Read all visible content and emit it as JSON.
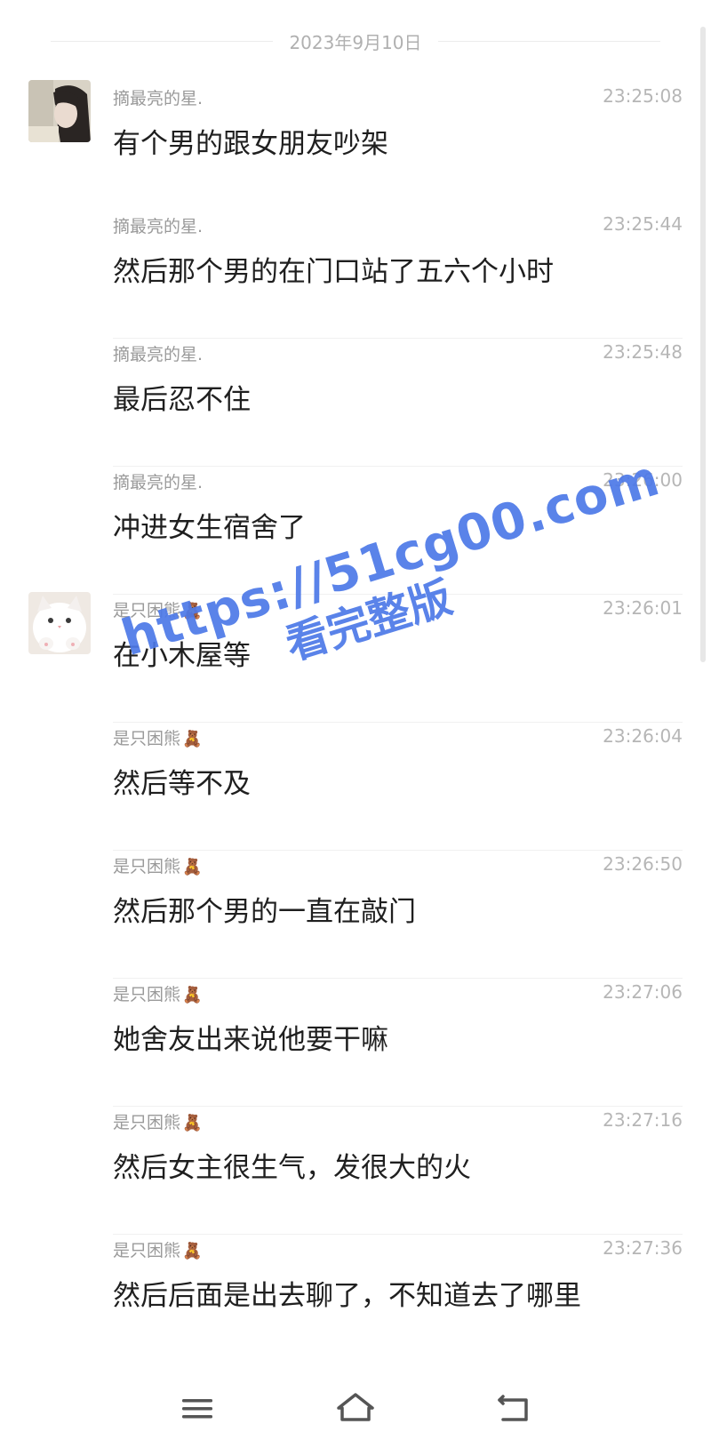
{
  "date_label": "2023年9月10日",
  "messages": [
    {
      "name": "摘最亮的星.",
      "time": "23:25:08",
      "text": "有个男的跟女朋友吵架",
      "avatar": "girl-photo"
    },
    {
      "name": "摘最亮的星.",
      "time": "23:25:44",
      "text": "然后那个男的在门口站了五六个小时"
    },
    {
      "name": "摘最亮的星.",
      "time": "23:25:48",
      "text": "最后忍不住"
    },
    {
      "name": "摘最亮的星.",
      "time": "23:26:00",
      "text": "冲进女生宿舍了"
    },
    {
      "name": "是只困熊",
      "time": "23:26:01",
      "text": "在小木屋等",
      "avatar": "cat-photo"
    },
    {
      "name": "是只困熊",
      "time": "23:26:04",
      "text": "然后等不及"
    },
    {
      "name": "是只困熊",
      "time": "23:26:50",
      "text": "然后那个男的一直在敲门"
    },
    {
      "name": "是只困熊",
      "time": "23:27:06",
      "text": "她舍友出来说他要干嘛"
    },
    {
      "name": "是只困熊",
      "time": "23:27:16",
      "text": "然后女主很生气，发很大的火"
    },
    {
      "name": "是只困熊",
      "time": "23:27:36",
      "text": "然后后面是出去聊了，不知道去了哪里"
    }
  ],
  "name_badge": "🧸",
  "watermark": {
    "line1": "https://51cg00.com",
    "line2": "看完整版"
  },
  "nav": {
    "menu_icon": "menu-icon",
    "home_icon": "home-icon",
    "back_icon": "back-icon"
  },
  "colors": {
    "watermark": "#4d79e8",
    "time": "#b6b6b6",
    "name": "#9a9a9a"
  }
}
